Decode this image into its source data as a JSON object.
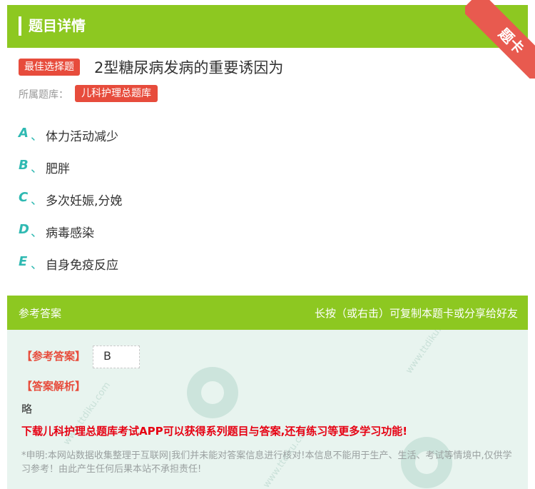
{
  "header": {
    "title": "题目详情",
    "ribbon": "题卡"
  },
  "question": {
    "type_badge": "最佳选择题",
    "stem": "2型糖尿病发病的重要诱因为",
    "bank_label": "所属题库：",
    "bank_name": "儿科护理总题库",
    "options": [
      {
        "letter": "A",
        "sep": "、",
        "text": "体力活动减少"
      },
      {
        "letter": "B",
        "sep": "、",
        "text": "肥胖"
      },
      {
        "letter": "C",
        "sep": "、",
        "text": "多次妊娠,分娩"
      },
      {
        "letter": "D",
        "sep": "、",
        "text": "病毒感染"
      },
      {
        "letter": "E",
        "sep": "、",
        "text": "自身免疫反应"
      }
    ]
  },
  "answer_panel": {
    "header_left": "参考答案",
    "header_right": "长按（或右击）可复制本题卡或分享给好友",
    "answer_label": "【参考答案】",
    "answer_value": "B",
    "analysis_label": "【答案解析】",
    "analysis_text": "略",
    "promo": "下载儿科护理总题库考试APP可以获得系列题目与答案,还有练习等更多学习功能!",
    "disclaimer": "*申明:本网站数据收集整理于互联网|我们并未能对答案信息进行核对!本信息不能用于生产、生活、考试等情境中,仅供学习参考！由此产生任何后果本站不承担责任!"
  },
  "watermark": {
    "site": "www.ttdiku.com"
  },
  "colors": {
    "green": "#8dc821",
    "red": "#e74c3c",
    "teal": "#2fb9b2",
    "promo_red": "#e60012"
  }
}
